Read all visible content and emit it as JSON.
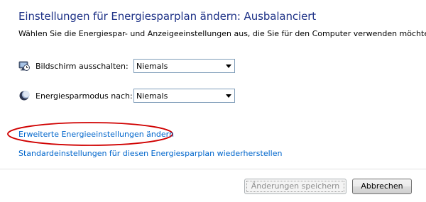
{
  "header": {
    "title": "Einstellungen für Energiesparplan ändern: Ausbalanciert",
    "subtitle": "Wählen Sie die Energiespar- und Anzeigeeinstellungen aus, die Sie für den Computer verwenden möchten."
  },
  "settings": {
    "display_off": {
      "icon": "monitor-clock-icon",
      "label": "Bildschirm ausschalten:",
      "value": "Niemals"
    },
    "sleep_after": {
      "icon": "moon-icon",
      "label": "Energiesparmodus nach:",
      "value": "Niemals"
    }
  },
  "links": {
    "advanced": "Erweiterte Energieeinstellungen ändern",
    "restore_defaults": "Standardeinstellungen für diesen Energiesparplan wiederherstellen"
  },
  "annotation": {
    "highlight_color": "#d00000"
  },
  "buttons": {
    "save_label": "Änderungen speichern",
    "save_enabled": false,
    "cancel_label": "Abbrechen"
  },
  "colors": {
    "title": "#1e3287",
    "link": "#0066cc"
  }
}
